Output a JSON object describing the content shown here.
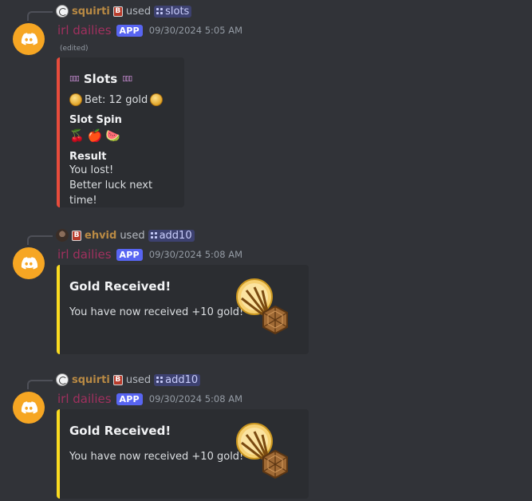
{
  "messages": [
    {
      "reply": {
        "user": "squirti",
        "badge": "B",
        "used": "used",
        "command": "slots"
      },
      "author": "irl dailies",
      "app_badge": "APP",
      "timestamp": "09/30/2024 5:05 AM",
      "edited": "(edited)",
      "embed": {
        "title": "Slots",
        "bet": "Bet: 12 gold",
        "spin_title": "Slot Spin",
        "spin_fruits": [
          "🍒",
          "🍎",
          "🍉"
        ],
        "result_title": "Result",
        "result_line1": "You lost!",
        "result_line2": "Better luck next time!",
        "accent": "#e74c3c"
      }
    },
    {
      "reply": {
        "user": "ehvid",
        "badge": "B",
        "used": "used",
        "command": "add10"
      },
      "author": "irl dailies",
      "app_badge": "APP",
      "timestamp": "09/30/2024 5:08 AM",
      "embed": {
        "title": "Gold Received!",
        "description": "You have now received +10 gold!",
        "accent": "#fadb20",
        "thumbnail": "gold-reward-icon"
      }
    },
    {
      "reply": {
        "user": "squirti",
        "badge": "B",
        "used": "used",
        "command": "add10"
      },
      "author": "irl dailies",
      "app_badge": "APP",
      "timestamp": "09/30/2024 5:08 AM",
      "embed": {
        "title": "Gold Received!",
        "description": "You have now received +10 gold!",
        "accent": "#fadb20",
        "thumbnail": "gold-reward-icon"
      }
    }
  ],
  "colors": {
    "background": "#313338",
    "embed_bg": "#2b2d31",
    "app_badge": "#5865f2",
    "author": "#a0305e",
    "avatar_bg": "#f6a623"
  }
}
